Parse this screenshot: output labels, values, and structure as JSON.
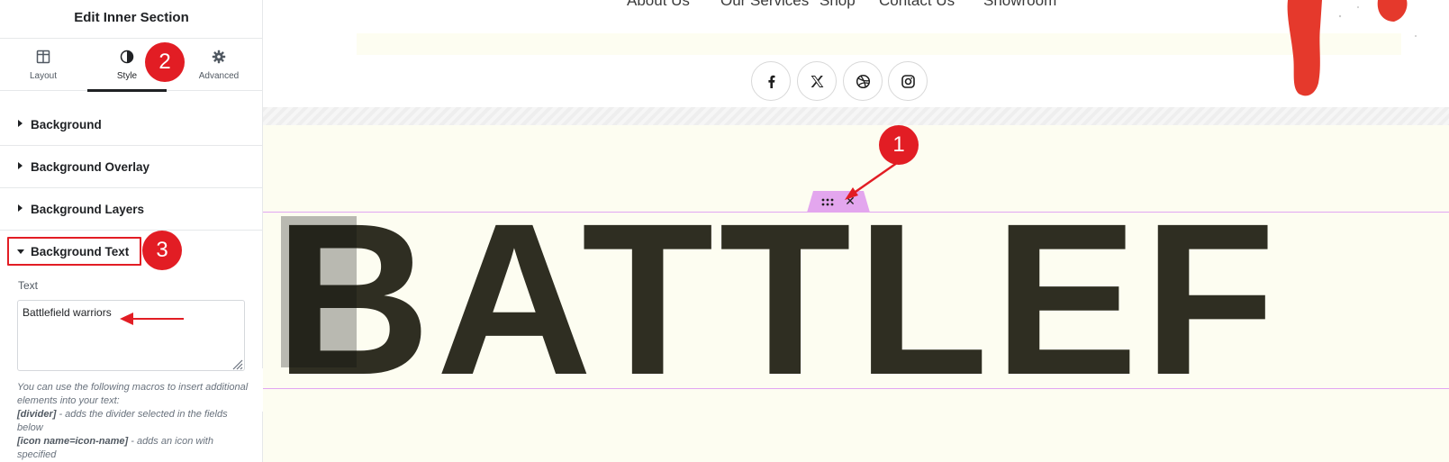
{
  "panel": {
    "title": "Edit Inner Section",
    "tabs": [
      {
        "label": "Layout",
        "icon": "columns-icon"
      },
      {
        "label": "Style",
        "icon": "half-circle-icon",
        "active": true
      },
      {
        "label": "Advanced",
        "icon": "gear-icon"
      }
    ],
    "sections": [
      {
        "label": "Background",
        "expanded": false
      },
      {
        "label": "Background Overlay",
        "expanded": false
      },
      {
        "label": "Background Layers",
        "expanded": false
      },
      {
        "label": "Background Text",
        "expanded": true
      }
    ],
    "text_field": {
      "label": "Text",
      "value": "Battlefield warriors"
    },
    "help": {
      "intro": "You can use the following macros to insert additional elements into your text:",
      "macro1_code": "[divider]",
      "macro1_desc": " - adds the divider selected in the fields below",
      "macro2_code": "[icon name=icon-name]",
      "macro2_desc": " - adds an icon with specified"
    },
    "collapse_glyph": "‹"
  },
  "canvas": {
    "nav": [
      "About Us",
      "Our Services",
      "Shop",
      "Contact Us",
      "Showroom"
    ],
    "social": [
      "facebook-icon",
      "x-icon",
      "dribbble-icon",
      "instagram-icon"
    ],
    "background_text": "BATTLEF",
    "handle_close": "✕",
    "colors": {
      "cream": "#fdfdf1",
      "big_text": "#2f2e22",
      "outline": "#e2a6f2",
      "annotation_red": "#e21d24"
    }
  },
  "annotations": {
    "badge1": "1",
    "badge2": "2",
    "badge3": "3"
  }
}
